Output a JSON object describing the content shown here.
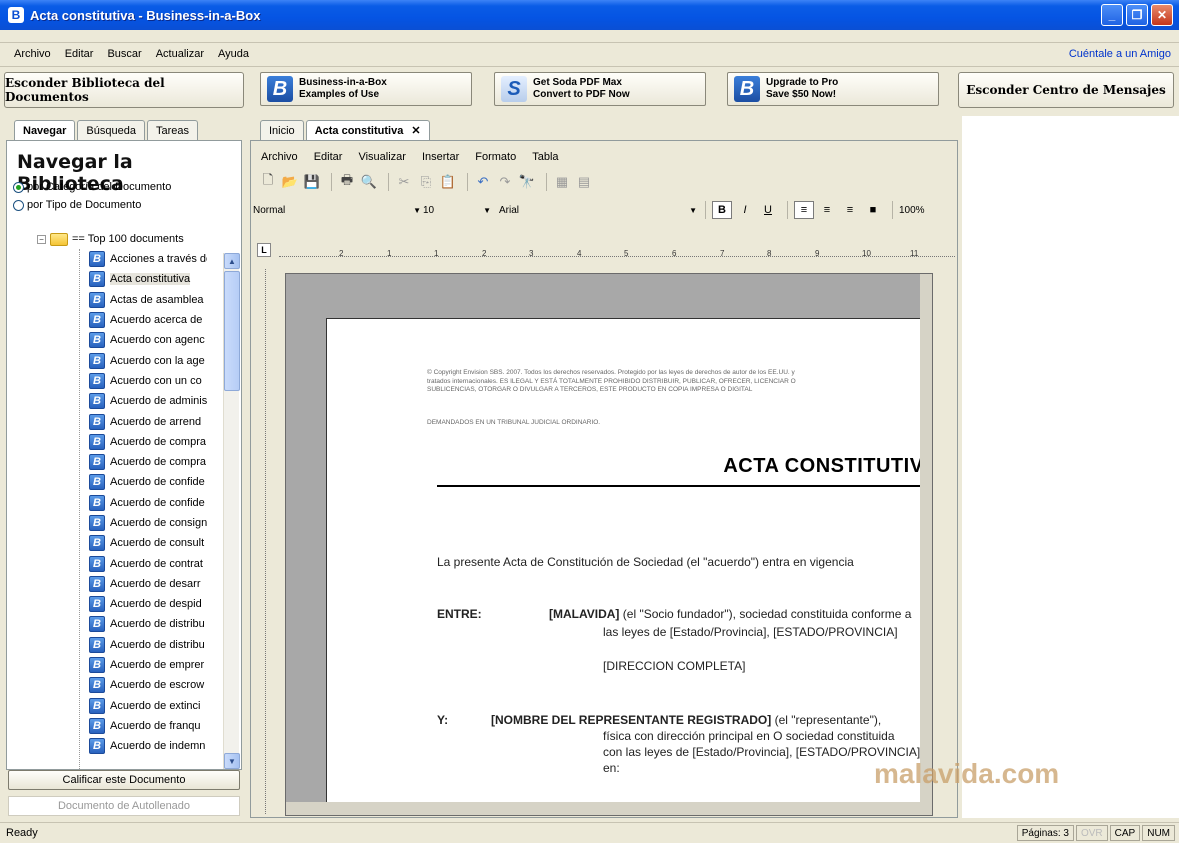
{
  "window": {
    "title": "Acta constitutiva - Business-in-a-Box"
  },
  "menubar": {
    "items": [
      "Archivo",
      "Editar",
      "Buscar",
      "Actualizar",
      "Ayuda"
    ],
    "amigo": "Cuéntale a un Amigo"
  },
  "buttons": {
    "hide_library": "Esconder Biblioteca del Documentos",
    "hide_messages": "Esconder Centro de Mensajes",
    "promo": [
      {
        "line1": "Business-in-a-Box",
        "line2": "Examples of Use"
      },
      {
        "line1": "Get Soda PDF Max",
        "line2": "Convert to PDF Now"
      },
      {
        "line1": "Upgrade to Pro",
        "line2": "Save $50 Now!"
      }
    ]
  },
  "left": {
    "tabs": [
      "Navegar",
      "Búsqueda",
      "Tareas"
    ],
    "title": "Navegar la Biblioteca",
    "radio1": "por Categoría del Documento",
    "radio2": "por Tipo de Documento",
    "root": "== Top 100 documents",
    "items": [
      "Acciones a través de",
      "Acta constitutiva",
      "Actas de asamblea",
      "Acuerdo acerca de",
      "Acuerdo con agenc",
      "Acuerdo con la age",
      "Acuerdo con un co",
      "Acuerdo de adminis",
      "Acuerdo de arrend",
      "Acuerdo de compra",
      "Acuerdo de compra",
      "Acuerdo de confide",
      "Acuerdo de confide",
      "Acuerdo de consign",
      "Acuerdo de consult",
      "Acuerdo de contrat",
      "Acuerdo de desarr",
      "Acuerdo de despid",
      "Acuerdo de distribu",
      "Acuerdo de distribu",
      "Acuerdo de emprer",
      "Acuerdo de escrow",
      "Acuerdo de extinci",
      "Acuerdo de franqu",
      "Acuerdo de indemn"
    ],
    "rate_btn": "Calificar este Documento",
    "autofill_btn": "Documento de Autollenado"
  },
  "doc": {
    "tabs": [
      "Inicio",
      "Acta constitutiva"
    ],
    "menu": [
      "Archivo",
      "Editar",
      "Visualizar",
      "Insertar",
      "Formato",
      "Tabla"
    ],
    "style": "Normal",
    "size": "10",
    "font": "Arial",
    "zoom": "100%",
    "copyright": [
      "© Copyright Envision SBS. 2007. Todos los derechos reservados. Protegido por las leyes de derechos de autor de los EE.UU. y",
      "tratados internacionales. ES ILEGAL Y ESTÁ TOTALMENTE PROHIBIDO DISTRIBUIR, PUBLICAR, OFRECER, LICENCIAR O",
      "SUBLICENCIAS, OTORGAR O DIVULGAR A TERCEROS, ESTE PRODUCTO EN COPIA IMPRESA O DIGITAL"
    ],
    "copyright2": "DEMANDADOS EN UN TRIBUNAL JUDICIAL ORDINARIO.",
    "title": "ACTA CONSTITUTIVA",
    "intro": "La presente Acta de Constitución de Sociedad (el \"acuerdo\") entra en vigencia",
    "entre_label": "ENTRE:",
    "entre_name": "[MALAVIDA]",
    "entre_rest": " (el \"Socio fundador\"), sociedad constituida conforme a",
    "entre_line2": "las leyes de [Estado/Provincia], [ESTADO/PROVINCIA]",
    "entre_addr": "[DIRECCION COMPLETA]",
    "y_label": "Y:",
    "y_name": "[NOMBRE DEL REPRESENTANTE REGISTRADO]",
    "y_rest": " (el \"representante\"),",
    "y_line2": "física con dirección principal en O sociedad constituida",
    "y_line3": "con las leyes de [Estado/Provincia], [ESTADO/PROVINCIA]",
    "y_line4": "en:",
    "ruler_nums": [
      "2",
      "1",
      "1",
      "2",
      "3",
      "4",
      "5",
      "6",
      "7",
      "8",
      "9",
      "10",
      "11"
    ]
  },
  "watermark": "malavida.com",
  "status": {
    "ready": "Ready",
    "pages": "Páginas: 3",
    "ovr": "OVR",
    "cap": "CAP",
    "num": "NUM"
  }
}
